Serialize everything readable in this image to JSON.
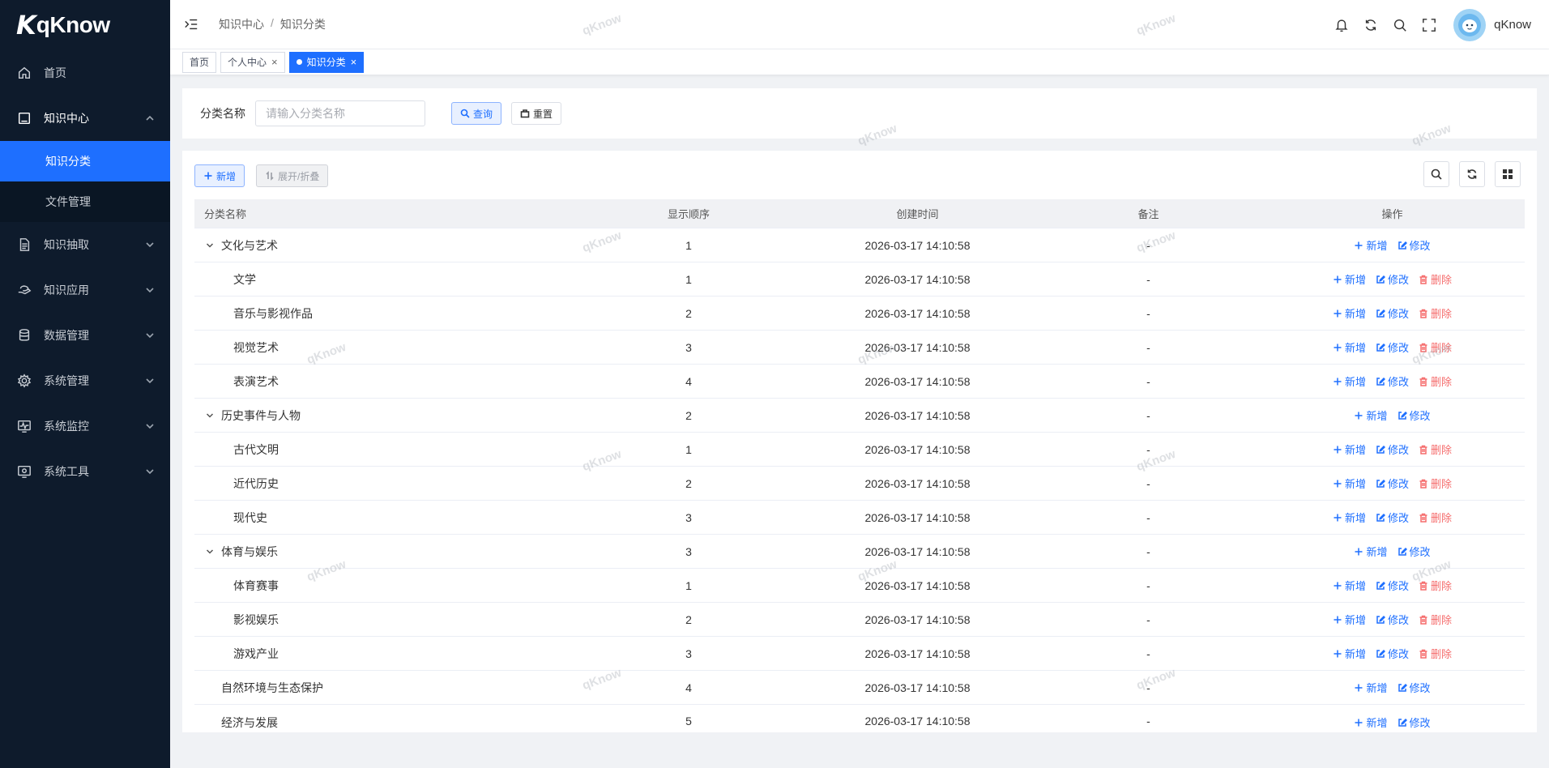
{
  "brand": {
    "name": "qKnow"
  },
  "sidebar": {
    "items": [
      {
        "label": "首页",
        "icon": "home-icon"
      },
      {
        "label": "知识中心",
        "icon": "book-icon",
        "open": true,
        "children": [
          {
            "label": "知识分类",
            "active": true
          },
          {
            "label": "文件管理"
          }
        ]
      },
      {
        "label": "知识抽取",
        "icon": "document-icon"
      },
      {
        "label": "知识应用",
        "icon": "hand-icon"
      },
      {
        "label": "数据管理",
        "icon": "database-icon"
      },
      {
        "label": "系统管理",
        "icon": "gear-icon"
      },
      {
        "label": "系统监控",
        "icon": "monitor-icon"
      },
      {
        "label": "系统工具",
        "icon": "tools-icon"
      }
    ]
  },
  "header": {
    "breadcrumb": [
      "知识中心",
      "知识分类"
    ],
    "separator": "/",
    "username": "qKnow"
  },
  "tags": [
    {
      "label": "首页",
      "closable": false,
      "active": false
    },
    {
      "label": "个人中心",
      "closable": true,
      "active": false
    },
    {
      "label": "知识分类",
      "closable": true,
      "active": true
    }
  ],
  "search": {
    "label": "分类名称",
    "placeholder": "请输入分类名称",
    "query_label": "查询",
    "reset_label": "重置"
  },
  "toolbar": {
    "add_label": "新增",
    "toggle_label": "展开/折叠"
  },
  "table": {
    "columns": [
      "分类名称",
      "显示顺序",
      "创建时间",
      "备注",
      "操作"
    ],
    "actions": {
      "add": "新增",
      "edit": "修改",
      "delete": "删除"
    },
    "rows": [
      {
        "name": "文化与艺术",
        "order": "1",
        "time": "2026-03-17 14:10:58",
        "note": "-",
        "level": 0,
        "expandable": true
      },
      {
        "name": "文学",
        "order": "1",
        "time": "2026-03-17 14:10:58",
        "note": "-",
        "level": 1
      },
      {
        "name": "音乐与影视作品",
        "order": "2",
        "time": "2026-03-17 14:10:58",
        "note": "-",
        "level": 1
      },
      {
        "name": "视觉艺术",
        "order": "3",
        "time": "2026-03-17 14:10:58",
        "note": "-",
        "level": 1
      },
      {
        "name": "表演艺术",
        "order": "4",
        "time": "2026-03-17 14:10:58",
        "note": "-",
        "level": 1
      },
      {
        "name": "历史事件与人物",
        "order": "2",
        "time": "2026-03-17 14:10:58",
        "note": "-",
        "level": 0,
        "expandable": true
      },
      {
        "name": "古代文明",
        "order": "1",
        "time": "2026-03-17 14:10:58",
        "note": "-",
        "level": 1
      },
      {
        "name": "近代历史",
        "order": "2",
        "time": "2026-03-17 14:10:58",
        "note": "-",
        "level": 1
      },
      {
        "name": "现代史",
        "order": "3",
        "time": "2026-03-17 14:10:58",
        "note": "-",
        "level": 1
      },
      {
        "name": "体育与娱乐",
        "order": "3",
        "time": "2026-03-17 14:10:58",
        "note": "-",
        "level": 0,
        "expandable": true
      },
      {
        "name": "体育赛事",
        "order": "1",
        "time": "2026-03-17 14:10:58",
        "note": "-",
        "level": 1
      },
      {
        "name": "影视娱乐",
        "order": "2",
        "time": "2026-03-17 14:10:58",
        "note": "-",
        "level": 1
      },
      {
        "name": "游戏产业",
        "order": "3",
        "time": "2026-03-17 14:10:58",
        "note": "-",
        "level": 1
      },
      {
        "name": "自然环境与生态保护",
        "order": "4",
        "time": "2026-03-17 14:10:58",
        "note": "-",
        "level": 0,
        "expandable": false
      },
      {
        "name": "经济与发展",
        "order": "5",
        "time": "2026-03-17 14:10:58",
        "note": "-",
        "level": 0,
        "expandable": false,
        "cut": true
      }
    ]
  },
  "watermark": {
    "text": "qKnow"
  },
  "colors": {
    "primary": "#1e6fff",
    "danger": "#f56c6c",
    "sidebar_bg": "#0e1b2c"
  }
}
